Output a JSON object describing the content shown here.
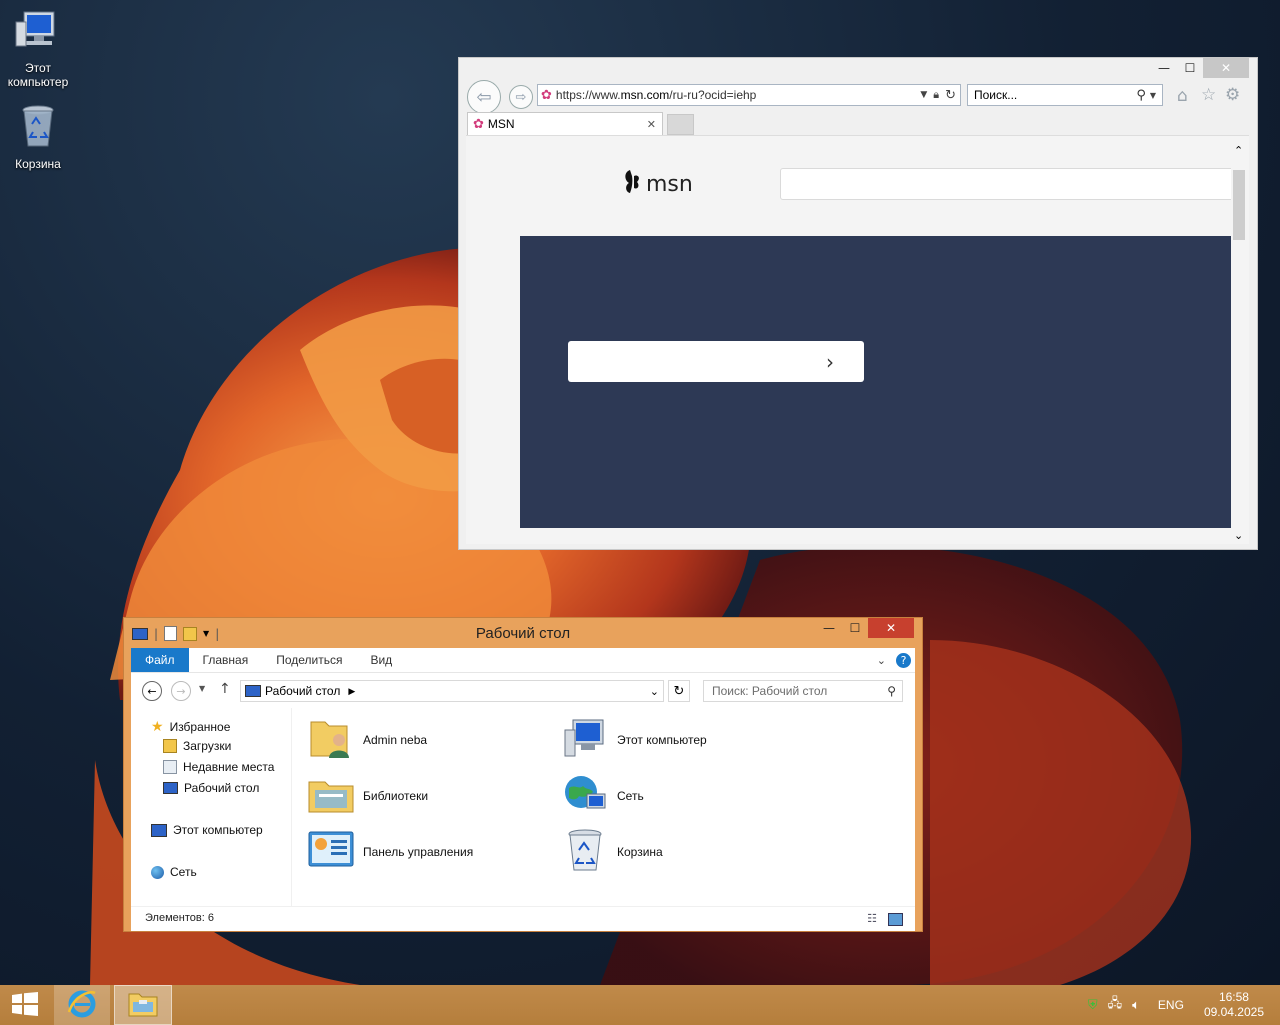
{
  "desktop": {
    "icons": [
      {
        "label": "Этот\nкомпьютер",
        "line1": "Этот",
        "line2": "компьютер",
        "icon": "computer-icon"
      },
      {
        "label": "Корзина",
        "icon": "recycle-bin-icon"
      }
    ]
  },
  "ie": {
    "window_buttons": {
      "minimize": "—",
      "maximize": "☐",
      "close": "✕"
    },
    "address_url_prefix": "https://www.",
    "address_url_domain": "msn.com",
    "address_url_suffix": "/ru-ru?ocid=iehp",
    "search_placeholder": "Поиск...",
    "tab_title": "MSN",
    "tab_close": "✕",
    "page": {
      "logo_text": "msn",
      "banner_chevron": "›"
    }
  },
  "explorer": {
    "title": "Рабочий стол",
    "window_buttons": {
      "minimize": "—",
      "maximize": "☐",
      "close": "✕"
    },
    "ribbon_tabs": [
      "Файл",
      "Главная",
      "Поделиться",
      "Вид"
    ],
    "breadcrumb": "Рабочий стол",
    "search_placeholder": "Поиск: Рабочий стол",
    "nav": {
      "favorites": "Избранное",
      "downloads": "Загрузки",
      "recent": "Недавние места",
      "desktop": "Рабочий стол",
      "computer": "Этот компьютер",
      "network": "Сеть"
    },
    "items": [
      {
        "label": "Admin neba",
        "icon": "user-folder-icon"
      },
      {
        "label": "Этот компьютер",
        "icon": "computer-icon"
      },
      {
        "label": "Библиотеки",
        "icon": "libraries-icon"
      },
      {
        "label": "Сеть",
        "icon": "network-icon"
      },
      {
        "label": "Панель управления",
        "icon": "control-panel-icon"
      },
      {
        "label": "Корзина",
        "icon": "recycle-bin-icon"
      }
    ],
    "status": "Элементов: 6"
  },
  "taskbar": {
    "language": "ENG",
    "time": "16:58",
    "date": "09.04.2025"
  },
  "colors": {
    "explorer_frame": "#e8a25c",
    "taskbar": "#b57e3c",
    "ribbon_file_tab": "#1979ca",
    "msn_banner": "#2d3955"
  }
}
